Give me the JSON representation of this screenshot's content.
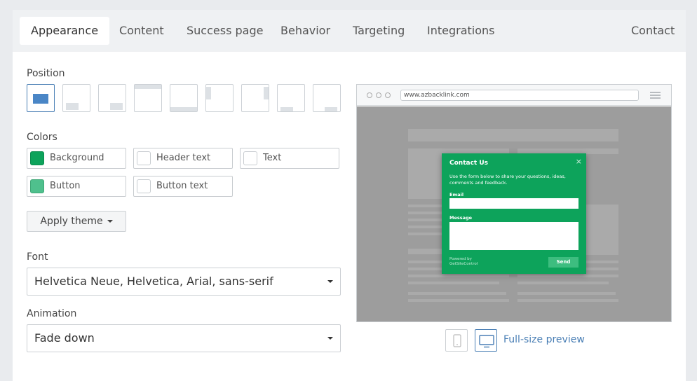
{
  "tabs": [
    {
      "label": "Appearance",
      "active": true
    },
    {
      "label": "Content"
    },
    {
      "label": "Success page"
    },
    {
      "label": "Behavior"
    },
    {
      "label": "Targeting"
    },
    {
      "label": "Integrations"
    }
  ],
  "contact_tab": "Contact",
  "position": {
    "label": "Position",
    "options": [
      "center-modal",
      "bottom-left",
      "bottom-right",
      "top-bar",
      "bottom-bar",
      "left-side",
      "right-side",
      "bottom-left-tab",
      "bottom-right-tab"
    ],
    "selected": "center-modal"
  },
  "colors": {
    "label": "Colors",
    "items": [
      {
        "label": "Background",
        "color": "#0da35b"
      },
      {
        "label": "Header text",
        "color": "#ffffff"
      },
      {
        "label": "Text",
        "color": "#ffffff"
      },
      {
        "label": "Button",
        "color": "#3dbd7f"
      },
      {
        "label": "Button text",
        "color": "#ffffff"
      }
    ]
  },
  "apply_theme": "Apply theme",
  "font": {
    "label": "Font",
    "value": "Helvetica Neue, Helvetica, Arial, sans-serif"
  },
  "animation": {
    "label": "Animation",
    "value": "Fade down"
  },
  "preview": {
    "url": "www.azbacklink.com",
    "popup": {
      "title": "Contact Us",
      "close": "×",
      "description": "Use the form below to share your questions, ideas, comments and feedback.",
      "email_label": "Email",
      "message_label": "Message",
      "powered_by": "Powered by\nGetSiteControl",
      "send": "Send"
    }
  },
  "devices": [
    "mobile-icon",
    "desktop-icon"
  ],
  "full_size_preview": "Full-size preview"
}
